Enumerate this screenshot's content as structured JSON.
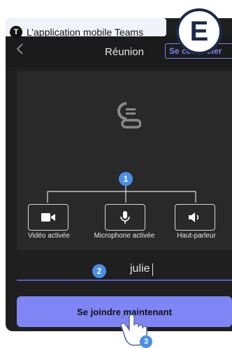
{
  "caption": {
    "badge": "T",
    "text": "L’application mobile Teams"
  },
  "corner_badge": "E",
  "header": {
    "back_icon": "chevron-left-icon",
    "title": "Réunion",
    "connect_label": "Se connecter"
  },
  "steps": {
    "one": "1",
    "two": "2",
    "three": "3"
  },
  "controls": [
    {
      "icon": "video-camera-icon",
      "label": "Vidéo activée"
    },
    {
      "icon": "microphone-icon",
      "label": "Microphone activée"
    },
    {
      "icon": "speaker-icon",
      "label": "Haut-parleur"
    }
  ],
  "name_input": {
    "value": "julie"
  },
  "join_button": {
    "label": "Se joindre maintenant"
  },
  "colors": {
    "accent": "#7f85f5",
    "step_badge": "#4a8ee6",
    "background": "#1f1f1f"
  }
}
